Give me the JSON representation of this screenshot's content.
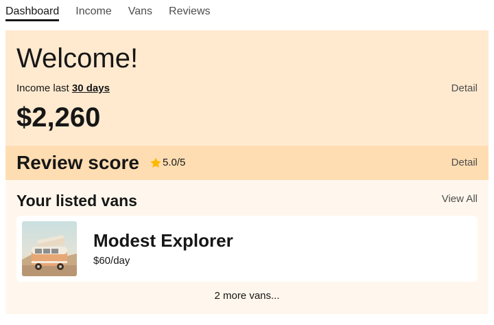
{
  "nav": {
    "items": [
      {
        "label": "Dashboard",
        "active": true
      },
      {
        "label": "Income",
        "active": false
      },
      {
        "label": "Vans",
        "active": false
      },
      {
        "label": "Reviews",
        "active": false
      }
    ]
  },
  "welcome": {
    "title": "Welcome!",
    "income_prefix": "Income last ",
    "income_period": "30 days",
    "detail_label": "Detail",
    "income_amount": "$2,260"
  },
  "reviews": {
    "title": "Review score",
    "star_icon": "star-icon",
    "score": "5.0/5",
    "detail_label": "Detail"
  },
  "vans": {
    "title": "Your listed vans",
    "view_all_label": "View All",
    "list": [
      {
        "name": "Modest Explorer",
        "price": "$60/day",
        "image_icon": "van-photo"
      }
    ],
    "more_label": "2 more vans..."
  },
  "colors": {
    "welcome_bg": "#ffead0",
    "reviews_bg": "#ffddb2",
    "vans_bg": "#fff7ed",
    "star": "#ffb800"
  }
}
